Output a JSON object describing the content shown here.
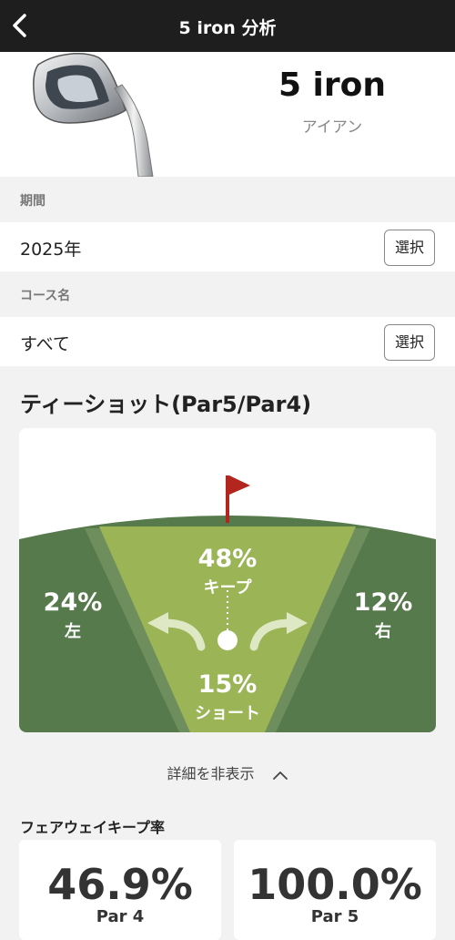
{
  "header": {
    "title": "5 iron 分析"
  },
  "club": {
    "name": "5 iron",
    "category": "アイアン"
  },
  "period": {
    "label": "期間",
    "value": "2025年",
    "select_label": "選択"
  },
  "course": {
    "label": "コース名",
    "value": "すべて",
    "select_label": "選択"
  },
  "tee_shot": {
    "title": "ティーショット(Par5/Par4)",
    "left": {
      "percent": "24%",
      "label": "左"
    },
    "keep": {
      "percent": "48%",
      "label": "キープ"
    },
    "right": {
      "percent": "12%",
      "label": "右"
    },
    "short": {
      "percent": "15%",
      "label": "ショート"
    }
  },
  "details_toggle": {
    "label": "詳細を非表示"
  },
  "fairway_keep": {
    "title": "フェアウェイキープ率",
    "par4": {
      "value": "46.9%",
      "label": "Par 4"
    },
    "par5": {
      "value": "100.0%",
      "label": "Par 5"
    }
  },
  "colors": {
    "header_bg": "#1e1e1e",
    "rough": "#567a4c",
    "fairway": "#9ab456",
    "flag": "#b3261e"
  }
}
